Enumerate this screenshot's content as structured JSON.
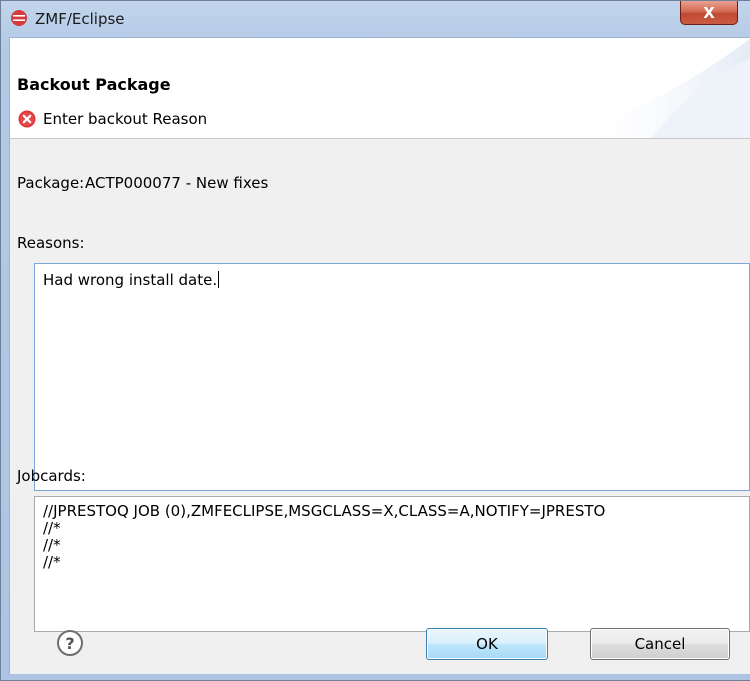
{
  "window": {
    "title": "ZMF/Eclipse",
    "close_label": "X",
    "icon": "eclipse-logo-icon"
  },
  "banner": {
    "title": "Backout Package",
    "error_message": "Enter backout Reason",
    "error_icon": "error-icon"
  },
  "package": {
    "label": "Package:",
    "value": "ACTP000077 - New fixes"
  },
  "reasons": {
    "label": "Reasons:",
    "value": "Had wrong install date."
  },
  "jobcards": {
    "label": "Jobcards:",
    "lines": [
      "//JPRESTOQ JOB (0),ZMFECLIPSE,MSGCLASS=X,CLASS=A,NOTIFY=JPRESTO",
      "//*",
      "//*",
      "//*"
    ]
  },
  "buttons": {
    "help_label": "?",
    "ok_label": "OK",
    "cancel_label": "Cancel"
  },
  "colors": {
    "error": "#d9383a",
    "accent_border": "#3c7fb1",
    "titlebar": "#b3c9e6"
  }
}
